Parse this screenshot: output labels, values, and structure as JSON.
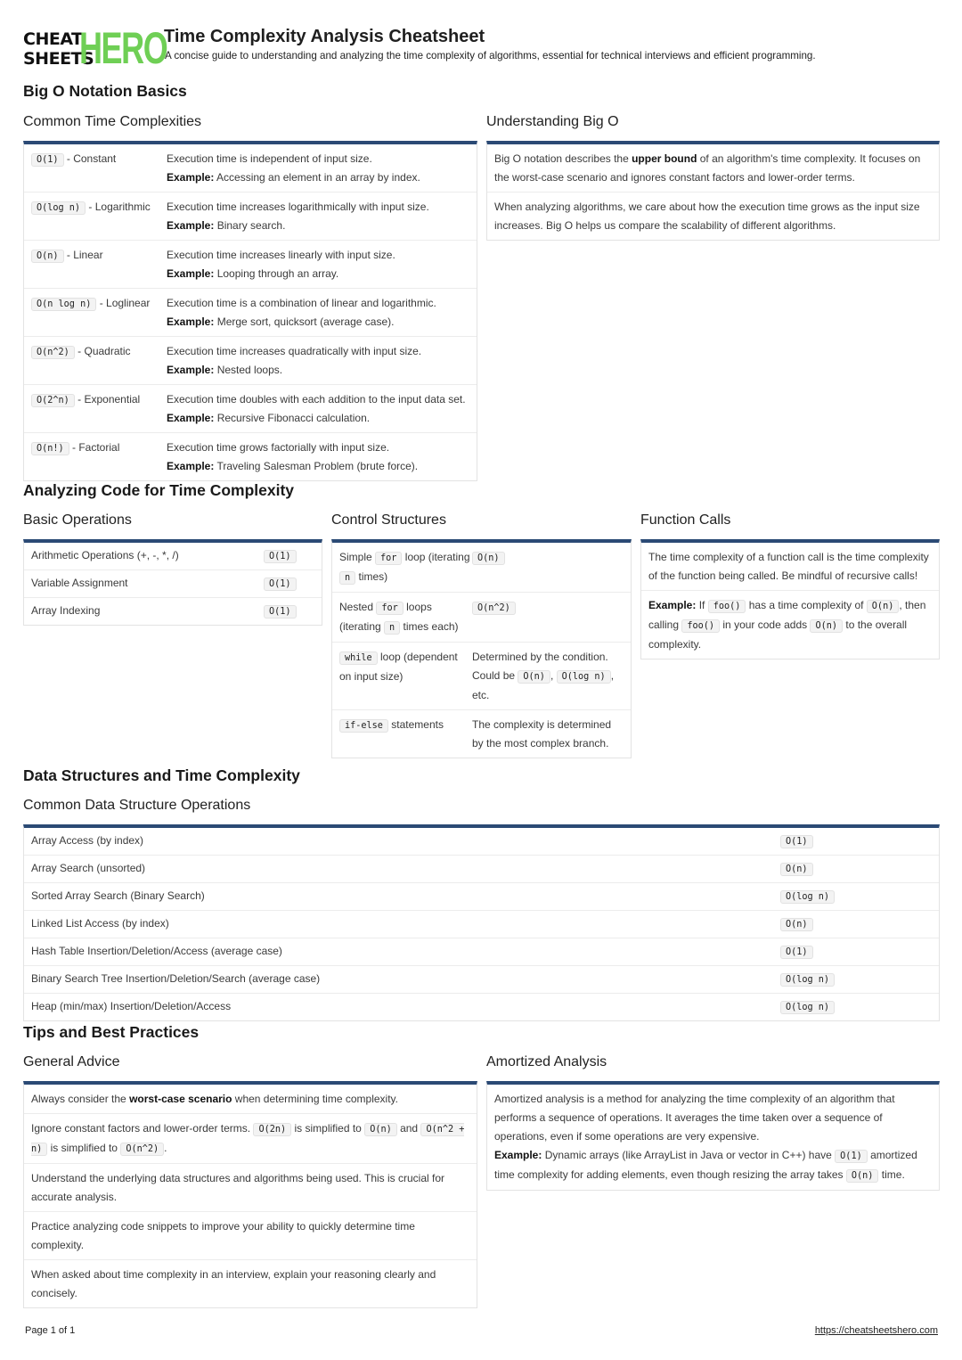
{
  "header": {
    "logo": {
      "line1": "CHEAT",
      "line2": "SHEETS",
      "hero": "HERO"
    },
    "title": "Time Complexity Analysis Cheatsheet",
    "subtitle": "A concise guide to understanding and analyzing the time complexity of algorithms, essential for technical interviews and efficient programming."
  },
  "colors": {
    "accent_bar": "#2b4a75",
    "logo_green": "#6fcf55"
  },
  "sections": {
    "big_o": {
      "title": "Big O Notation Basics",
      "common": {
        "title": "Common Time Complexities",
        "example_label": "Example:",
        "rows": [
          {
            "code": "O(1)",
            "name": "- Constant",
            "desc": "Execution time is independent of input size.",
            "example": "Accessing an element in an array by index."
          },
          {
            "code": "O(log n)",
            "name": "- Logarithmic",
            "desc": "Execution time increases logarithmically with input size.",
            "example": "Binary search."
          },
          {
            "code": "O(n)",
            "name": "- Linear",
            "desc": "Execution time increases linearly with input size.",
            "example": "Looping through an array."
          },
          {
            "code": "O(n log n)",
            "name": "- Loglinear",
            "desc": "Execution time is a combination of linear and logarithmic.",
            "example": "Merge sort, quicksort (average case)."
          },
          {
            "code": "O(n^2)",
            "name": "- Quadratic",
            "desc": "Execution time increases quadratically with input size.",
            "example": "Nested loops."
          },
          {
            "code": "O(2^n)",
            "name": "- Exponential",
            "desc": "Execution time doubles with each addition to the input data set.",
            "example": "Recursive Fibonacci calculation."
          },
          {
            "code": "O(n!)",
            "name": "- Factorial",
            "desc": "Execution time grows factorially with input size.",
            "example": "Traveling Salesman Problem (brute force)."
          }
        ]
      },
      "understanding": {
        "title": "Understanding Big O",
        "p1_pre": "Big O notation describes the ",
        "p1_bold": "upper bound",
        "p1_post": " of an algorithm's time complexity. It focuses on the worst-case scenario and ignores constant factors and lower-order terms.",
        "p2": "When analyzing algorithms, we care about how the execution time grows as the input size increases. Big O helps us compare the scalability of different algorithms."
      }
    },
    "analyzing": {
      "title": "Analyzing Code for Time Complexity",
      "basic": {
        "title": "Basic Operations",
        "rows": [
          {
            "label": "Arithmetic Operations (+, -, *, /)",
            "value": "O(1)"
          },
          {
            "label": "Variable Assignment",
            "value": "O(1)"
          },
          {
            "label": "Array Indexing",
            "value": "O(1)"
          }
        ]
      },
      "control": {
        "title": "Control Structures",
        "r1": {
          "pre": "Simple",
          "code": "for",
          "mid": "loop (iterating",
          "code2": "n",
          "post": "times)",
          "value": "O(n)"
        },
        "r2": {
          "pre": "Nested",
          "code": "for",
          "mid": "loops (iterating",
          "code2": "n",
          "post": "times each)",
          "value": "O(n^2)"
        },
        "r3": {
          "code": "while",
          "post": "loop (dependent on input size)",
          "v_pre": "Determined by the condition. Could be",
          "v_code1": "O(n)",
          "v_sep": ",",
          "v_code2": "O(log n)",
          "v_post": ", etc."
        },
        "r4": {
          "code": "if-else",
          "post": "statements",
          "value": "The complexity is determined by the most complex branch."
        }
      },
      "functions": {
        "title": "Function Calls",
        "p1": "The time complexity of a function call is the time complexity of the function being called. Be mindful of recursive calls!",
        "p2": {
          "label": "Example:",
          "t1": "If",
          "c1": "foo()",
          "t2": "has a time complexity of",
          "c2": "O(n)",
          "t3": ", then calling",
          "c3": "foo()",
          "t4": "in your code adds",
          "c4": "O(n)",
          "t5": "to the overall complexity."
        }
      }
    },
    "data_structures": {
      "title": "Data Structures and Time Complexity",
      "ops": {
        "title": "Common Data Structure Operations",
        "rows": [
          {
            "label": "Array Access (by index)",
            "value": "O(1)"
          },
          {
            "label": "Array Search (unsorted)",
            "value": "O(n)"
          },
          {
            "label": "Sorted Array Search (Binary Search)",
            "value": "O(log n)"
          },
          {
            "label": "Linked List Access (by index)",
            "value": "O(n)"
          },
          {
            "label": "Hash Table Insertion/Deletion/Access (average case)",
            "value": "O(1)"
          },
          {
            "label": "Binary Search Tree Insertion/Deletion/Search (average case)",
            "value": "O(log n)"
          },
          {
            "label": "Heap (min/max) Insertion/Deletion/Access",
            "value": "O(log n)"
          }
        ]
      }
    },
    "tips": {
      "title": "Tips and Best Practices",
      "general": {
        "title": "General Advice",
        "t1": {
          "pre": "Always consider the ",
          "bold": "worst-case scenario",
          "post": " when determining time complexity."
        },
        "t2": {
          "pre": "Ignore constant factors and lower-order terms.",
          "c1": "O(2n)",
          "m1": "is simplified to",
          "c2": "O(n)",
          "m2": "and",
          "c3": "O(n^2 + n)",
          "m3": "is simplified to",
          "c4": "O(n^2)",
          "post": "."
        },
        "t3": "Understand the underlying data structures and algorithms being used. This is crucial for accurate analysis.",
        "t4": "Practice analyzing code snippets to improve your ability to quickly determine time complexity.",
        "t5": "When asked about time complexity in an interview, explain your reasoning clearly and concisely."
      },
      "amortized": {
        "title": "Amortized Analysis",
        "p1": "Amortized analysis is a method for analyzing the time complexity of an algorithm that performs a sequence of operations. It averages the time taken over a sequence of operations, even if some operations are very expensive.",
        "label": "Example:",
        "t1": "Dynamic arrays (like ArrayList in Java or vector in C++) have",
        "c1": "O(1)",
        "t2": "amortized time complexity for adding elements, even though resizing the array takes",
        "c2": "O(n)",
        "t3": "time."
      }
    }
  },
  "footer": {
    "page": "Page 1 of 1",
    "link": "https://cheatsheetshero.com"
  }
}
